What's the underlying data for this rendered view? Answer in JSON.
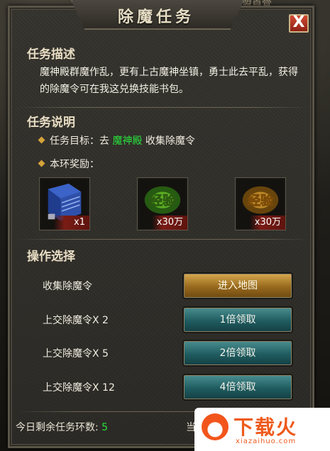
{
  "background": {
    "top_text": "盟首骨"
  },
  "window": {
    "title": "除魔任务",
    "close_label": "X"
  },
  "task_description": {
    "heading": "任务描述",
    "text": "魔神殿群魔作乱，更有上古魔神坐镇，勇士此去平乱，获得的除魔令可在我这兑换技能书包。"
  },
  "task_info": {
    "heading": "任务说明",
    "goal_prefix": "任务目标：去 ",
    "goal_location": "魔神殿",
    "goal_suffix": " 收集除魔令",
    "reward_label": "本环奖励：",
    "rewards": [
      {
        "icon": "skill-book-icon",
        "quantity": "x1"
      },
      {
        "icon": "exp-green-icon",
        "quantity": "x30万",
        "caption": "经验"
      },
      {
        "icon": "exp-gold-icon",
        "quantity": "x30万",
        "caption": "经验"
      }
    ]
  },
  "operations": {
    "heading": "操作选择",
    "rows": [
      {
        "label": "收集除魔令",
        "button": "进入地图",
        "style": "gold"
      },
      {
        "label": "上交除魔令X 2",
        "button": "1倍领取",
        "style": "teal"
      },
      {
        "label": "上交除魔令X 5",
        "button": "2倍领取",
        "style": "teal"
      },
      {
        "label": "上交除魔令X 12",
        "button": "4倍领取",
        "style": "teal"
      }
    ]
  },
  "footer": {
    "remaining_label": "今日剩余任务环数:",
    "remaining_value": "5",
    "right_text": "当"
  },
  "watermark": {
    "brand": "下载火",
    "url": "xiazaihuo.com"
  },
  "colors": {
    "highlight_green": "#27e13c",
    "gold_button": "#c08a2c",
    "teal_button": "#2a6c70",
    "close_red": "#b8321f",
    "brand_orange": "#ee5a1c"
  }
}
